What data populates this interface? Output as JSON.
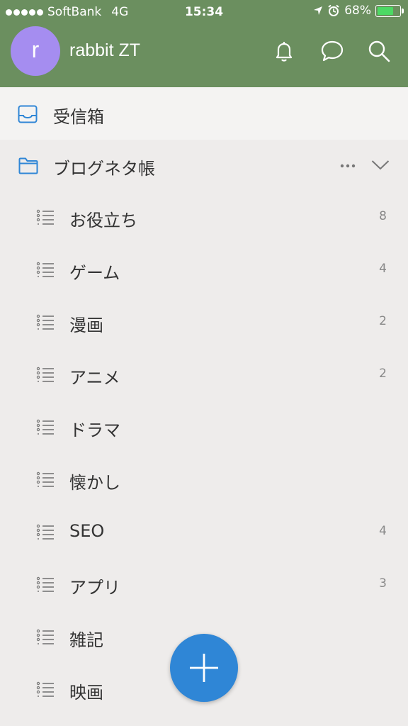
{
  "status_bar": {
    "carrier": "SoftBank",
    "network": "4G",
    "time": "15:34",
    "battery": "68%",
    "battery_level": 0.68
  },
  "header": {
    "avatar_initial": "r",
    "username": "rabbit ZT",
    "avatar_color": "#a58df0",
    "background_color": "#6b8f5f",
    "icons": [
      "bell-icon",
      "chat-icon",
      "search-icon"
    ]
  },
  "inbox": {
    "label": "受信箱",
    "icon": "inbox-icon"
  },
  "folder": {
    "label": "ブログネタ帳",
    "icon": "folder-icon",
    "expanded": true
  },
  "lists": [
    {
      "label": "お役立ち",
      "count": "8"
    },
    {
      "label": "ゲーム",
      "count": "4"
    },
    {
      "label": "漫画",
      "count": "2"
    },
    {
      "label": "アニメ",
      "count": "2"
    },
    {
      "label": "ドラマ",
      "count": ""
    },
    {
      "label": "懐かし",
      "count": ""
    },
    {
      "label": "SEO",
      "count": "4"
    },
    {
      "label": "アプリ",
      "count": "3"
    },
    {
      "label": "雑記",
      "count": ""
    },
    {
      "label": "映画",
      "count": ""
    }
  ],
  "fab": {
    "icon": "plus-icon",
    "color": "#2f86d6"
  }
}
